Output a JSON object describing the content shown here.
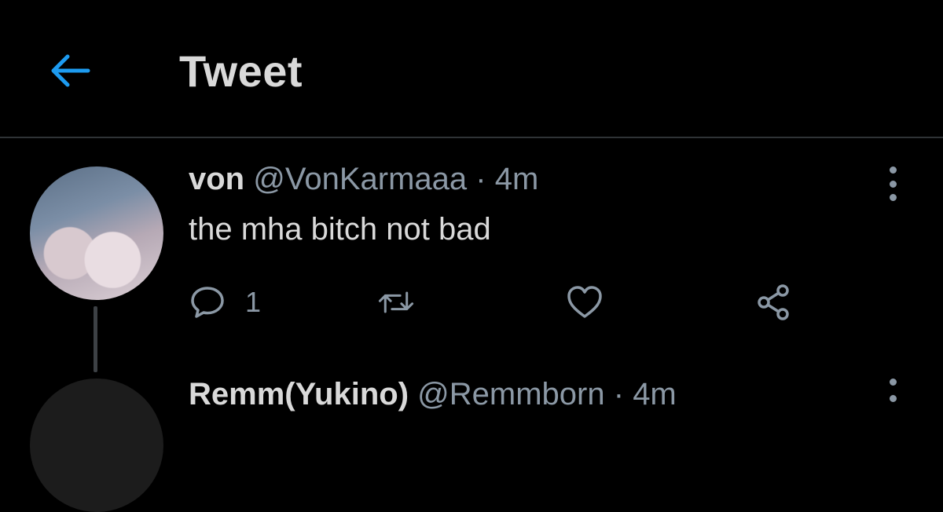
{
  "header": {
    "title": "Tweet",
    "back_icon": "arrow-left-icon"
  },
  "colors": {
    "background": "#000000",
    "accent": "#1d9bf0",
    "secondary_text": "#8b98a5",
    "primary_text": "#d9d9d9",
    "divider": "#2f3336"
  },
  "tweet": {
    "name": "von",
    "handle": "@VonKarmaaa",
    "separator": "·",
    "time": "4m",
    "text": "the mha bitch not bad",
    "reply_count": "1",
    "icons": [
      "reply-icon",
      "retweet-icon",
      "like-icon",
      "share-icon",
      "more-icon"
    ]
  },
  "next_tweet": {
    "name": "Remm(Yukino)",
    "handle": "@Remmborn",
    "separator": "·",
    "time": "4m"
  }
}
